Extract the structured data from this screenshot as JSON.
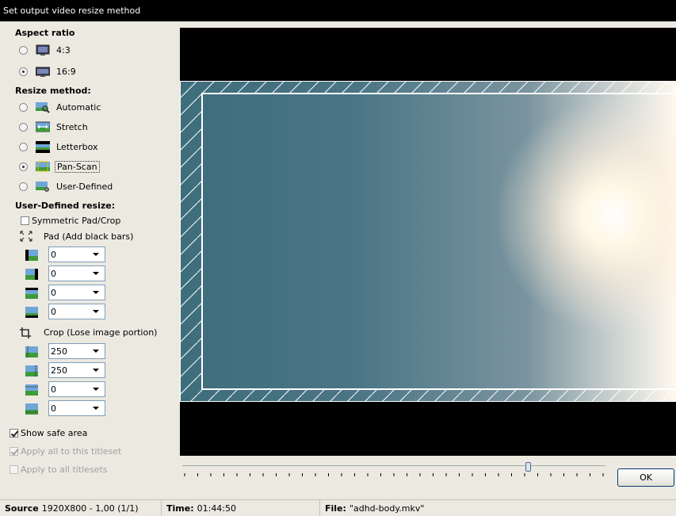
{
  "window": {
    "title": "Set output video resize method"
  },
  "aspect": {
    "heading": "Aspect ratio",
    "options": [
      {
        "label": "4:3",
        "selected": false
      },
      {
        "label": "16:9",
        "selected": true
      }
    ]
  },
  "resize": {
    "heading": "Resize method:",
    "options": [
      {
        "label": "Automatic",
        "selected": false
      },
      {
        "label": "Stretch",
        "selected": false
      },
      {
        "label": "Letterbox",
        "selected": false
      },
      {
        "label": "Pan-Scan",
        "selected": true
      },
      {
        "label": "User-Defined",
        "selected": false
      }
    ]
  },
  "user_defined": {
    "heading": "User-Defined resize:",
    "symmetric_label": "Symmetric Pad/Crop",
    "symmetric_checked": false,
    "pad_label": "Pad (Add black bars)",
    "pad_values": [
      "0",
      "0",
      "0",
      "0"
    ],
    "crop_label": "Crop (Lose image portion)",
    "crop_values": [
      "250",
      "250",
      "0",
      "0"
    ]
  },
  "options": {
    "show_safe_area": {
      "label": "Show safe area",
      "checked": true,
      "enabled": true
    },
    "apply_titleset": {
      "label": "Apply all to this titleset",
      "checked": true,
      "enabled": false
    },
    "apply_all": {
      "label": "Apply to all titlesets",
      "checked": false,
      "enabled": false
    }
  },
  "slider": {
    "position_fraction": 0.81
  },
  "ok_label": "OK",
  "status": {
    "source_label": "Source",
    "source_value": "1920X800 - 1,00 (1/1)",
    "time_label": "Time:",
    "time_value": "01:44:50",
    "file_label": "File:",
    "file_value": "\"adhd-body.mkv\""
  },
  "colors": {
    "accent": "#0a246a",
    "safe_area": "#ffffff",
    "preview_bg": "#000000"
  }
}
